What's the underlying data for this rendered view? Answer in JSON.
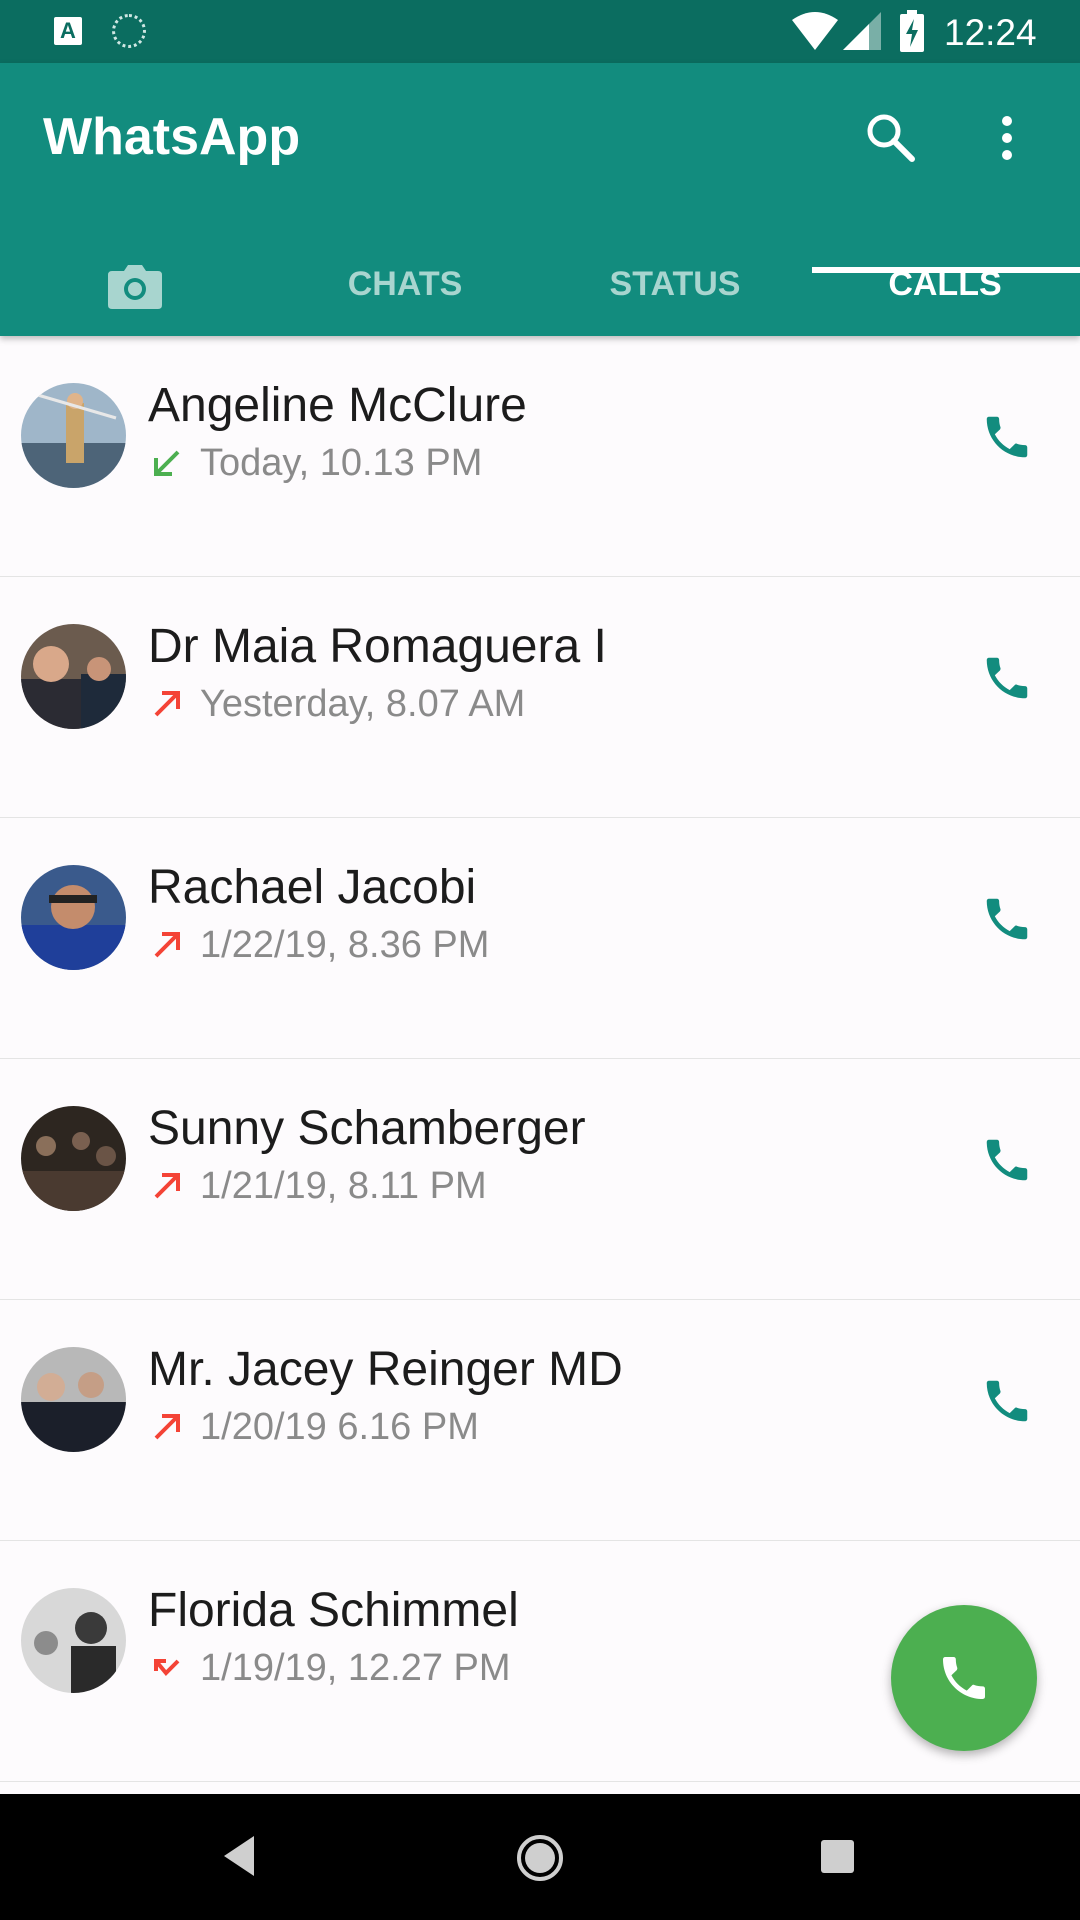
{
  "status_bar": {
    "keyboard_indicator": "A",
    "time": "12:24",
    "icons": [
      "keyboard-icon",
      "sync-icon",
      "wifi-icon",
      "signal-icon",
      "battery-charging-icon"
    ]
  },
  "app_bar": {
    "title": "WhatsApp",
    "actions": [
      "search-icon",
      "more-vert-icon"
    ]
  },
  "tabs": [
    {
      "label": "",
      "icon": "camera-icon",
      "active": false
    },
    {
      "label": "CHATS",
      "active": false
    },
    {
      "label": "STATUS",
      "active": false
    },
    {
      "label": "CALLS",
      "active": true
    }
  ],
  "calls": [
    {
      "name": "Angeline McClure",
      "time": "Today, 10.13 PM",
      "direction": "incoming",
      "direction_color": "#4caf50",
      "avatar": "beach-kite-photo"
    },
    {
      "name": "Dr Maia Romaguera I",
      "time": "Yesterday, 8.07 AM",
      "direction": "outgoing",
      "direction_color": "#f44336",
      "avatar": "men-in-suits-photo"
    },
    {
      "name": "Rachael Jacobi",
      "time": "1/22/19, 8.36 PM",
      "direction": "outgoing",
      "direction_color": "#f44336",
      "avatar": "cyclist-photo"
    },
    {
      "name": "Sunny Schamberger",
      "time": "1/21/19, 8.11 PM",
      "direction": "outgoing",
      "direction_color": "#f44336",
      "avatar": "crowd-photo"
    },
    {
      "name": "Mr. Jacey Reinger MD",
      "time": "1/20/19 6.16 PM",
      "direction": "outgoing",
      "direction_color": "#f44336",
      "avatar": "conference-photo"
    },
    {
      "name": "Florida Schimmel",
      "time": "1/19/19, 12.27 PM",
      "direction": "missed",
      "direction_color": "#f44336",
      "avatar": "bw-people-photo"
    }
  ],
  "fab": {
    "icon": "new-call-icon",
    "color": "#4caf50"
  },
  "colors": {
    "primary": "#128c7e",
    "status_bar": "#0b6d60",
    "accent": "#4caf50",
    "call_icon": "#128c7e"
  },
  "nav_bar": {
    "buttons": [
      "back-icon",
      "home-icon",
      "recents-icon"
    ]
  }
}
